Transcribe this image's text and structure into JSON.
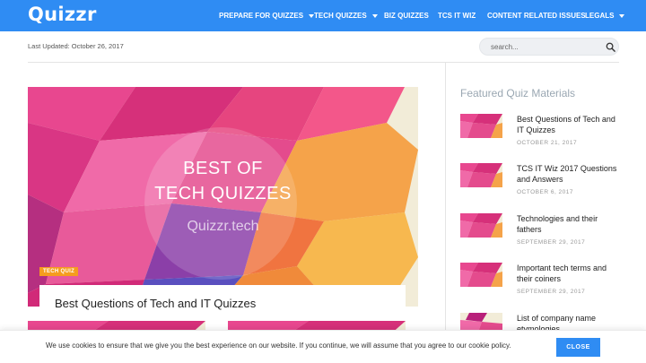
{
  "brand": {
    "logo": "Quizzr",
    "accent": "#2f8cf3"
  },
  "nav": [
    {
      "label": "PREPARE FOR QUIZZES",
      "dropdown": true
    },
    {
      "label": "TECH QUIZZES",
      "dropdown": true
    },
    {
      "label": "BIZ QUIZZES",
      "dropdown": false
    },
    {
      "label": "TCS IT WIZ",
      "dropdown": false
    },
    {
      "label": "CONTENT RELATED ISSUES",
      "dropdown": false
    },
    {
      "label": "LEGALS",
      "dropdown": true
    }
  ],
  "header": {
    "last_updated": "Last Updated: October 26, 2017",
    "search_placeholder": "search..."
  },
  "featured_post": {
    "image_title_line1": "BEST OF",
    "image_title_line2": "TECH QUIZZES",
    "image_brand": "Quizzr.tech",
    "category": "TECH QUIZ",
    "title": "Best Questions of Tech and IT Quizzes"
  },
  "sidebar": {
    "heading": "Featured Quiz Materials",
    "items": [
      {
        "title": "Best Questions of Tech and IT Quizzes",
        "date": "OCTOBER 21, 2017"
      },
      {
        "title": "TCS IT Wiz 2017 Questions and Answers",
        "date": "OCTOBER 6, 2017"
      },
      {
        "title": "Technologies and their fathers",
        "date": "SEPTEMBER 29, 2017"
      },
      {
        "title": "Important tech terms and their coiners",
        "date": "SEPTEMBER 29, 2017"
      },
      {
        "title": "List of company name etymologies",
        "date": ""
      }
    ]
  },
  "cookie": {
    "text": "We use cookies to ensure that we give you the best experience on our website. If you continue, we will assume that you agree to our cookie policy.",
    "button": "CLOSE"
  }
}
